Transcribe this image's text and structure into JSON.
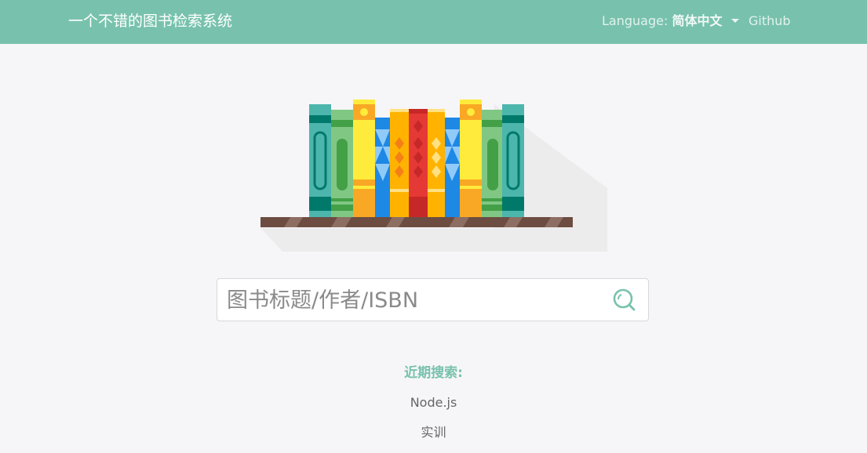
{
  "navbar": {
    "brand": "一个不错的图书检索系统",
    "language_label": "Language:",
    "language_value": "简体中文",
    "github_label": "Github"
  },
  "hero": {
    "illustration": "bookshelf-illustration",
    "colors": {
      "teal": "#4db6ac",
      "teal_dark": "#00796b",
      "green": "#81c784",
      "green_dark": "#43a047",
      "yellow": "#ffeb3b",
      "orange": "#f9a825",
      "blue": "#1e88e5",
      "light_blue": "#90caf9",
      "amber": "#ffb300",
      "red": "#e53935",
      "shelf": "#6d4c41",
      "shadow": "#ececec"
    }
  },
  "search": {
    "placeholder": "图书标题/作者/ISBN",
    "value": "",
    "icon": "search-icon"
  },
  "recent": {
    "title": "近期搜索:",
    "items": [
      "Node.js",
      "实训"
    ]
  },
  "colors": {
    "primary": "#78c2ad",
    "background": "#f6f6f8"
  }
}
